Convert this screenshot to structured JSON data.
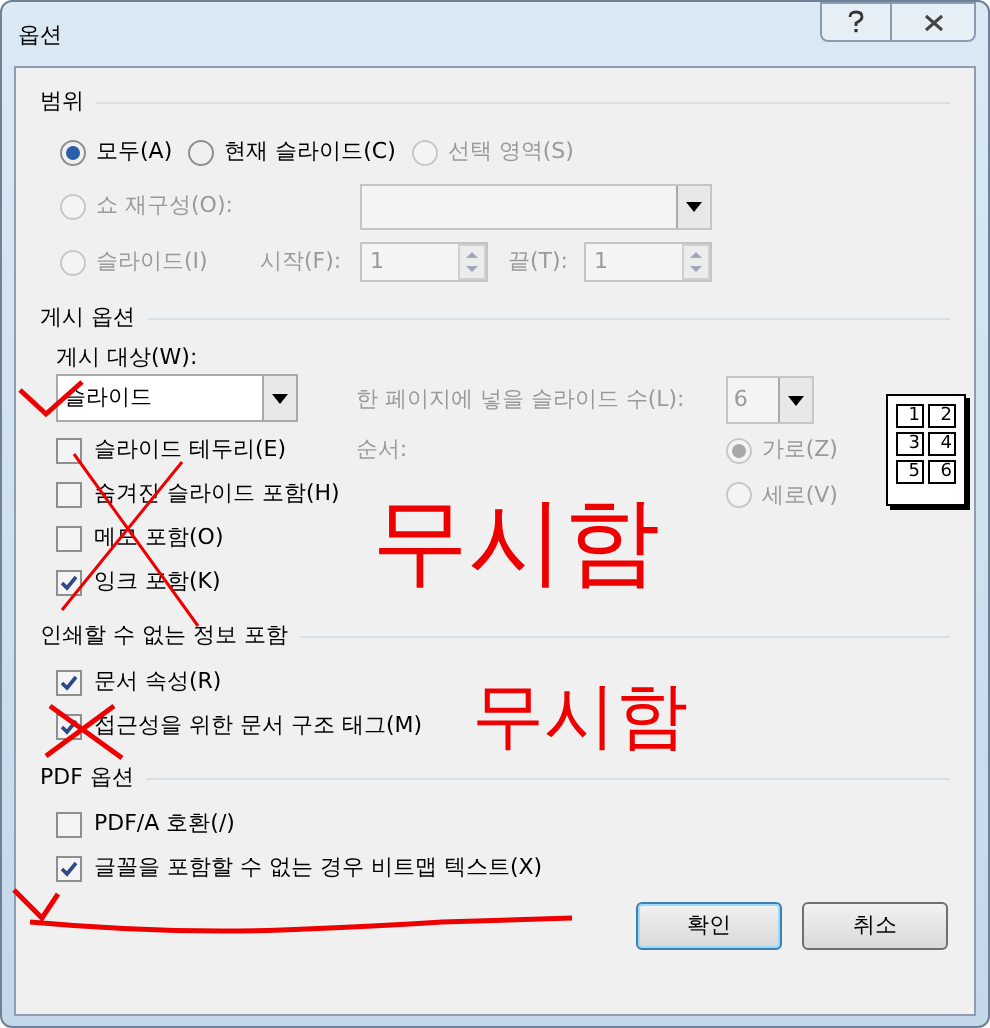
{
  "window": {
    "title": "옵션"
  },
  "range": {
    "heading": "범위",
    "options": [
      {
        "label": "모두(A)",
        "selected": true,
        "disabled": false
      },
      {
        "label": "현재 슬라이드(C)",
        "selected": false,
        "disabled": false
      },
      {
        "label": "선택 영역(S)",
        "selected": false,
        "disabled": true
      }
    ],
    "custom_show": {
      "label": "쇼 재구성(O):",
      "selected": false,
      "disabled": true
    },
    "slides": {
      "label": "슬라이드(I)",
      "selected": false,
      "disabled": true,
      "from_label": "시작(F):",
      "from_value": "1",
      "to_label": "끝(T):",
      "to_value": "1"
    }
  },
  "publish": {
    "heading": "게시 옵션",
    "target_label": "게시 대상(W):",
    "target_value": "슬라이드",
    "checkboxes": [
      {
        "label": "슬라이드 테두리(E)",
        "checked": false
      },
      {
        "label": "숨겨진 슬라이드 포함(H)",
        "checked": false
      },
      {
        "label": "메모 포함(O)",
        "checked": false
      },
      {
        "label": "잉크 포함(K)",
        "checked": true
      }
    ],
    "per_page_label": "한 페이지에 넣을 슬라이드 수(L):",
    "per_page_value": "6",
    "order_label": "순서:",
    "order_options": [
      {
        "label": "가로(Z)",
        "selected": true
      },
      {
        "label": "세로(V)",
        "selected": false
      }
    ],
    "disabled": true,
    "preview_numbers": [
      "1",
      "2",
      "3",
      "4",
      "5",
      "6"
    ]
  },
  "nonprint": {
    "heading": "인쇄할 수 없는 정보 포함",
    "checkboxes": [
      {
        "label": "문서 속성(R)",
        "checked": true
      },
      {
        "label": "접근성을 위한 문서 구조 태그(M)",
        "checked": true
      }
    ]
  },
  "pdf": {
    "heading": "PDF 옵션",
    "checkboxes": [
      {
        "label": "PDF/A 호환(/)",
        "checked": false
      },
      {
        "label": "글꼴을 포함할 수 없는 경우 비트맵 텍스트(X)",
        "checked": true
      }
    ]
  },
  "buttons": [
    {
      "label": "확인",
      "default": true
    },
    {
      "label": "취소",
      "default": false
    }
  ],
  "annotations": [
    {
      "text": "무시함"
    },
    {
      "text": "무시함"
    }
  ]
}
